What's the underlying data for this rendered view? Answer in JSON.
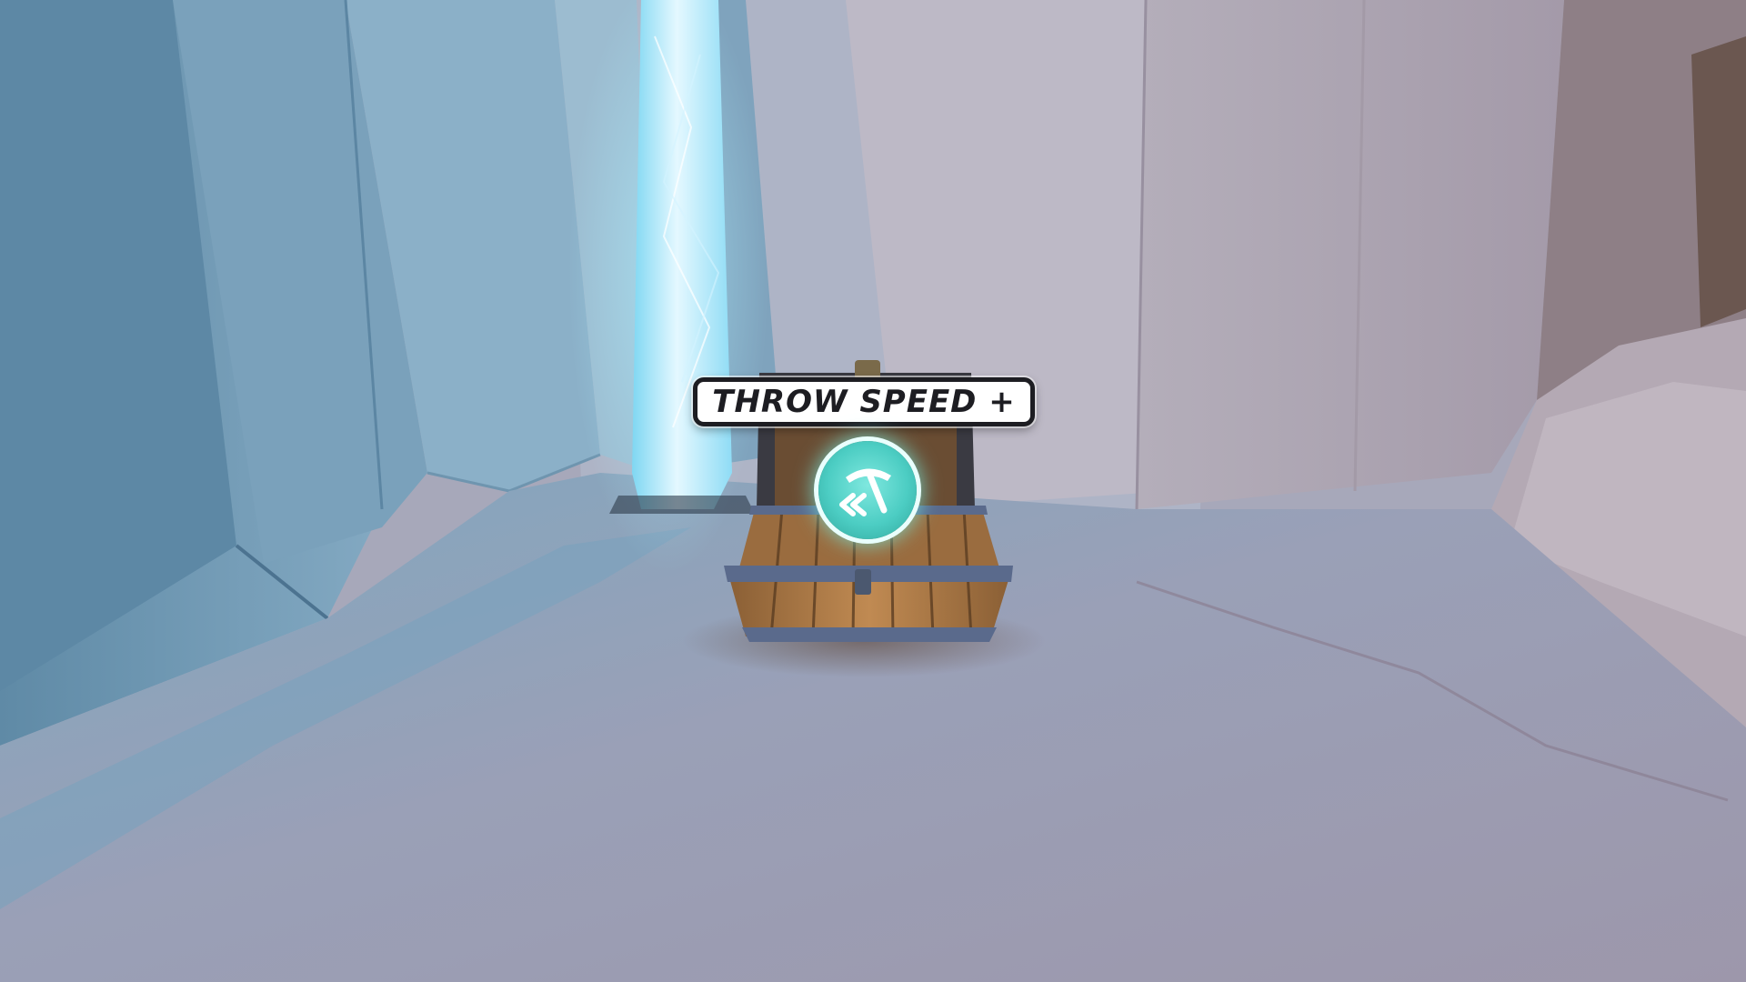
{
  "pickup": {
    "label": "THROW SPEED +",
    "icon": "pickaxe-speed-icon"
  },
  "colors": {
    "crystal": "#bfefff",
    "orb": "#4ccdc3",
    "label_bg": "#ffffff",
    "label_border": "#1d1d22"
  }
}
